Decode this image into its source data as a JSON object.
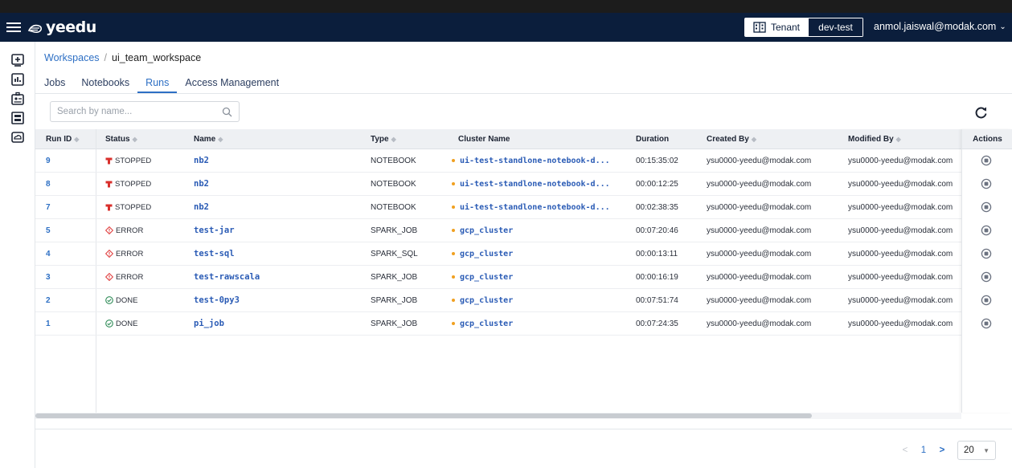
{
  "header": {
    "brand": "yeedu",
    "tenant_label": "Tenant",
    "tenant_value": "dev-test",
    "user_email": "anmol.jaiswal@modak.com"
  },
  "sidebar": {
    "icons": [
      "add-workspace-icon",
      "dashboard-icon",
      "id-badge-icon",
      "clusters-icon",
      "cloud-drive-icon"
    ]
  },
  "breadcrumb": {
    "root": "Workspaces",
    "separator": "/",
    "current": "ui_team_workspace"
  },
  "tabs": [
    "Jobs",
    "Notebooks",
    "Runs",
    "Access Management"
  ],
  "active_tab": "Runs",
  "search": {
    "placeholder": "Search by name..."
  },
  "table": {
    "columns": [
      "Run ID",
      "Status",
      "Name",
      "Type",
      "Cluster Name",
      "Duration",
      "Created By",
      "Modified By",
      "Actions"
    ],
    "rows": [
      {
        "id": "9",
        "status": "STOPPED",
        "name": "nb2",
        "type": "NOTEBOOK",
        "cluster": "ui-test-standlone-notebook-d...",
        "duration": "00:15:35:02",
        "created_by": "ysu0000-yeedu@modak.com",
        "modified_by": "ysu0000-yeedu@modak.com"
      },
      {
        "id": "8",
        "status": "STOPPED",
        "name": "nb2",
        "type": "NOTEBOOK",
        "cluster": "ui-test-standlone-notebook-d...",
        "duration": "00:00:12:25",
        "created_by": "ysu0000-yeedu@modak.com",
        "modified_by": "ysu0000-yeedu@modak.com"
      },
      {
        "id": "7",
        "status": "STOPPED",
        "name": "nb2",
        "type": "NOTEBOOK",
        "cluster": "ui-test-standlone-notebook-d...",
        "duration": "00:02:38:35",
        "created_by": "ysu0000-yeedu@modak.com",
        "modified_by": "ysu0000-yeedu@modak.com"
      },
      {
        "id": "5",
        "status": "ERROR",
        "name": "test-jar",
        "type": "SPARK_JOB",
        "cluster": "gcp_cluster",
        "duration": "00:07:20:46",
        "created_by": "ysu0000-yeedu@modak.com",
        "modified_by": "ysu0000-yeedu@modak.com"
      },
      {
        "id": "4",
        "status": "ERROR",
        "name": "test-sql",
        "type": "SPARK_SQL",
        "cluster": "gcp_cluster",
        "duration": "00:00:13:11",
        "created_by": "ysu0000-yeedu@modak.com",
        "modified_by": "ysu0000-yeedu@modak.com"
      },
      {
        "id": "3",
        "status": "ERROR",
        "name": "test-rawscala",
        "type": "SPARK_JOB",
        "cluster": "gcp_cluster",
        "duration": "00:00:16:19",
        "created_by": "ysu0000-yeedu@modak.com",
        "modified_by": "ysu0000-yeedu@modak.com"
      },
      {
        "id": "2",
        "status": "DONE",
        "name": "test-0py3",
        "type": "SPARK_JOB",
        "cluster": "gcp_cluster",
        "duration": "00:07:51:74",
        "created_by": "ysu0000-yeedu@modak.com",
        "modified_by": "ysu0000-yeedu@modak.com"
      },
      {
        "id": "1",
        "status": "DONE",
        "name": "pi_job",
        "type": "SPARK_JOB",
        "cluster": "gcp_cluster",
        "duration": "00:07:24:35",
        "created_by": "ysu0000-yeedu@modak.com",
        "modified_by": "ysu0000-yeedu@modak.com"
      }
    ]
  },
  "pagination": {
    "prev": "<",
    "page": "1",
    "next": ">",
    "page_size": "20"
  },
  "colors": {
    "topbar": "#0b1e3c",
    "link": "#2d6fc4",
    "stopped": "#d9302c",
    "error": "#e04040",
    "done": "#2e8b57",
    "cluster_dot": "#f0a020"
  }
}
